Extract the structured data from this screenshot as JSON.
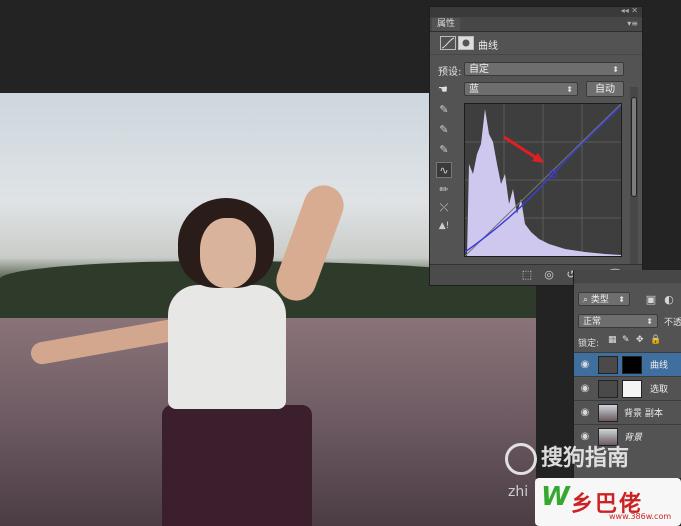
{
  "properties_panel": {
    "tab_label": "属性",
    "adjustment_title": "曲线",
    "preset_label": "预设:",
    "preset_value": "自定",
    "channel_value": "蓝",
    "auto_button": "自动"
  },
  "layers_panel": {
    "filter_kind": "类型",
    "blend_mode": "正常",
    "opacity_label": "不透",
    "lock_label": "锁定:",
    "layers": [
      {
        "name": "曲线",
        "selected": true
      },
      {
        "name": "选取",
        "selected": false
      },
      {
        "name": "背景 副本",
        "selected": false
      },
      {
        "name": "背景",
        "selected": false
      }
    ]
  },
  "watermark": {
    "brand": "搜狗指南",
    "prefix": "zhi",
    "logo_text": "乡巴佬",
    "logo_url": "www.386w.com"
  },
  "colors": {
    "panel_bg": "#535353",
    "curve_line": "#3b3bd6",
    "histogram": "#cfc8ee",
    "annotation_arrow": "#e02020"
  }
}
